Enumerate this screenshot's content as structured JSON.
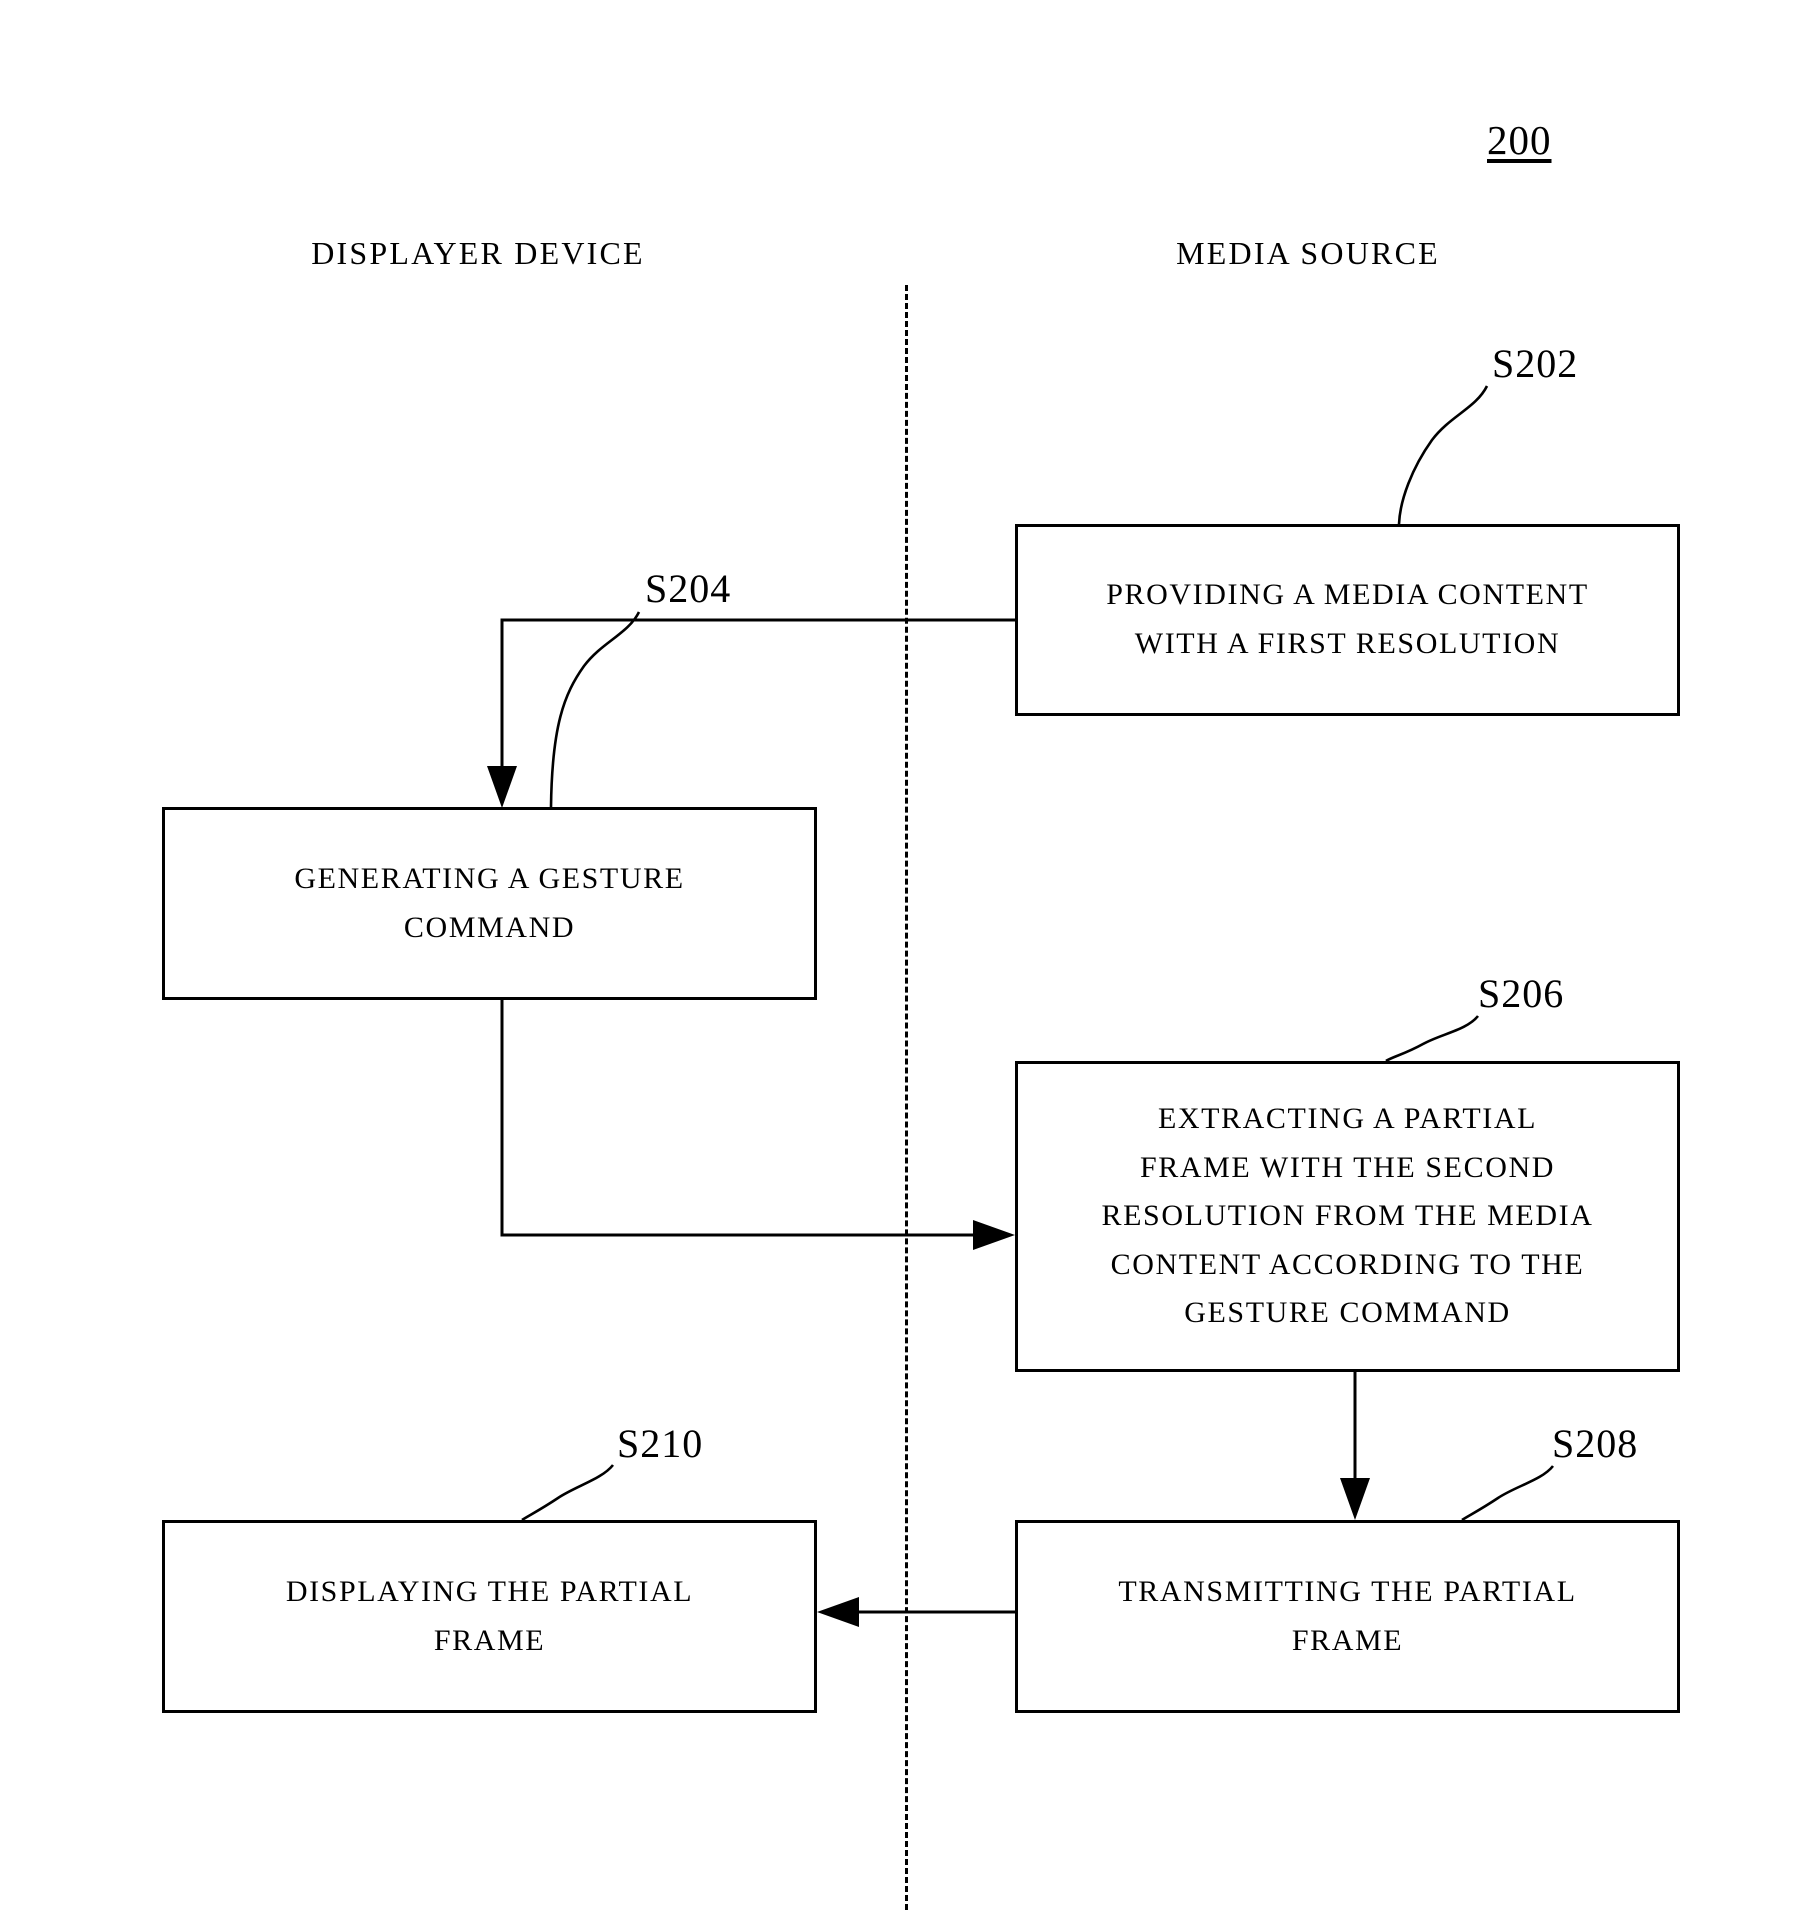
{
  "figure": {
    "number": "200"
  },
  "lanes": [
    {
      "id": "displayer-device",
      "label": "DISPLAYER DEVICE"
    },
    {
      "id": "media-source",
      "label": "MEDIA SOURCE"
    }
  ],
  "steps": [
    {
      "ref": "S202",
      "lane": "media-source",
      "text": "PROVIDING A MEDIA CONTENT\nWITH A FIRST RESOLUTION"
    },
    {
      "ref": "S204",
      "lane": "displayer-device",
      "text": "GENERATING A GESTURE\nCOMMAND"
    },
    {
      "ref": "S206",
      "lane": "media-source",
      "text": "EXTRACTING A PARTIAL\nFRAME WITH THE SECOND\nRESOLUTION FROM THE MEDIA\nCONTENT ACCORDING TO THE\nGESTURE COMMAND"
    },
    {
      "ref": "S208",
      "lane": "media-source",
      "text": "TRANSMITTING THE PARTIAL\nFRAME"
    },
    {
      "ref": "S210",
      "lane": "displayer-device",
      "text": "DISPLAYING THE PARTIAL\nFRAME"
    }
  ],
  "flow": [
    {
      "from": "S202",
      "to": "S204"
    },
    {
      "from": "S204",
      "to": "S206"
    },
    {
      "from": "S206",
      "to": "S208"
    },
    {
      "from": "S208",
      "to": "S210"
    }
  ],
  "colors": {
    "ink": "#000000",
    "background": "#ffffff"
  }
}
